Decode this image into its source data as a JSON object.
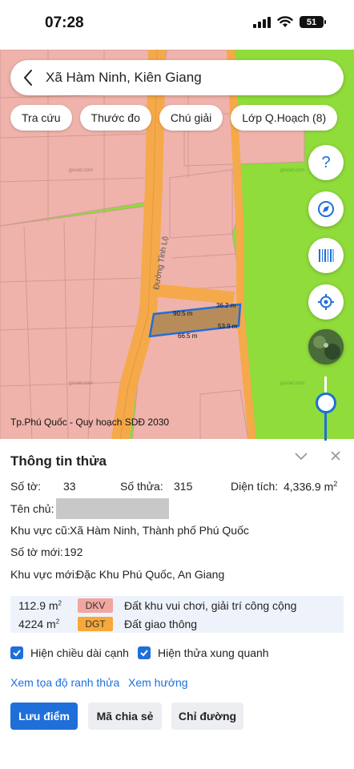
{
  "status": {
    "time": "07:28",
    "battery": "51"
  },
  "search": {
    "text": "Xã Hàm Ninh, Kiên Giang"
  },
  "chips": [
    "Tra cứu",
    "Thước đo",
    "Chú giải",
    "Lớp Q.Hoạch (8)"
  ],
  "map": {
    "road_label": "Đường Tỉnh Lộ",
    "watermark": "gisviet.com",
    "dimensions": [
      "90.5 m",
      "36.2 m",
      "66.5 m",
      "53.9 m"
    ],
    "caption": "Tp.Phú Quốc - Quy hoạch SDĐ 2030",
    "colors": {
      "residential": "#efb3ab",
      "green": "#8fdc3a",
      "road": "#f5a94a",
      "parcel": "#1e6fd9"
    }
  },
  "fabs": [
    "help-icon",
    "compass-icon",
    "barcode-icon",
    "locate-icon",
    "satellite-layer-icon"
  ],
  "panel": {
    "title": "Thông tin thửa",
    "so_to_label": "Số tờ:",
    "so_to_value": "33",
    "so_thua_label": "Số thửa:",
    "so_thua_value": "315",
    "dien_tich_label": "Diện tích:",
    "dien_tich_value": "4,336.9 m",
    "dien_tich_unit_sup": "2",
    "ten_chu_label": "Tên chủ:",
    "khu_vuc_cu_label": "Khu vực cũ:",
    "khu_vuc_cu_value": "Xã Hàm Ninh, Thành phố Phú Quốc",
    "so_to_moi_label": "Số tờ mới:",
    "so_to_moi_value": "192",
    "khu_vuc_moi_label": "Khu vực mới:",
    "khu_vuc_moi_value": "Đặc Khu Phú Quốc, An Giang",
    "landuse": [
      {
        "area": "112.9 m",
        "sup": "2",
        "code": "DKV",
        "desc": "Đất khu vui chơi, giải trí công cộng"
      },
      {
        "area": "4224 m",
        "sup": "2",
        "code": "DGT",
        "desc": "Đất giao thông"
      }
    ],
    "check_edge_length": "Hiện chiều dài cạnh",
    "check_surrounding": "Hiện thửa xung quanh",
    "link_coords": "Xem tọa độ ranh thửa",
    "link_direction": "Xem hướng",
    "btn_save": "Lưu điểm",
    "btn_share": "Mã chia sẻ",
    "btn_route": "Chỉ đường"
  }
}
